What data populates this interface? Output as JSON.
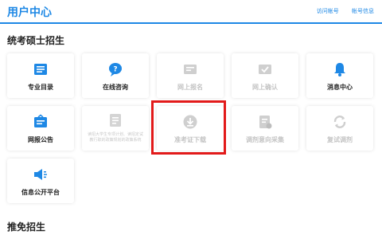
{
  "header": {
    "title": "用户中心",
    "links": [
      "访问帐号",
      "帐号信息"
    ]
  },
  "section1": {
    "title": "统考硕士招生",
    "cards": [
      {
        "label": "专业目录",
        "icon": "book-list-icon",
        "enabled": true
      },
      {
        "label": "在线咨询",
        "icon": "chat-question-icon",
        "enabled": true
      },
      {
        "label": "网上报名",
        "icon": "id-card-icon",
        "enabled": false
      },
      {
        "label": "网上确认",
        "icon": "id-check-icon",
        "enabled": false
      },
      {
        "label": "消息中心",
        "icon": "bell-icon",
        "enabled": true
      },
      {
        "label": "网报公告",
        "icon": "notice-board-icon",
        "enabled": true
      },
      {
        "label": "",
        "icon": "document-icon",
        "enabled": false,
        "desc": "读招大学生专项计划、读招定试教行职的政策规划的政策系统"
      },
      {
        "label": "准考证下载",
        "icon": "download-circle-icon",
        "enabled": false
      },
      {
        "label": "调剂意向采集",
        "icon": "form-edit-icon",
        "enabled": false
      },
      {
        "label": "复试调剂",
        "icon": "refresh-arrows-icon",
        "enabled": false
      },
      {
        "label": "信息公开平台",
        "icon": "megaphone-icon",
        "enabled": true
      }
    ]
  },
  "section2": {
    "title": "推免招生"
  },
  "colors": {
    "accent": "#1e88e5",
    "disabled": "#c4c4c4",
    "highlight": "#e21a1a"
  }
}
